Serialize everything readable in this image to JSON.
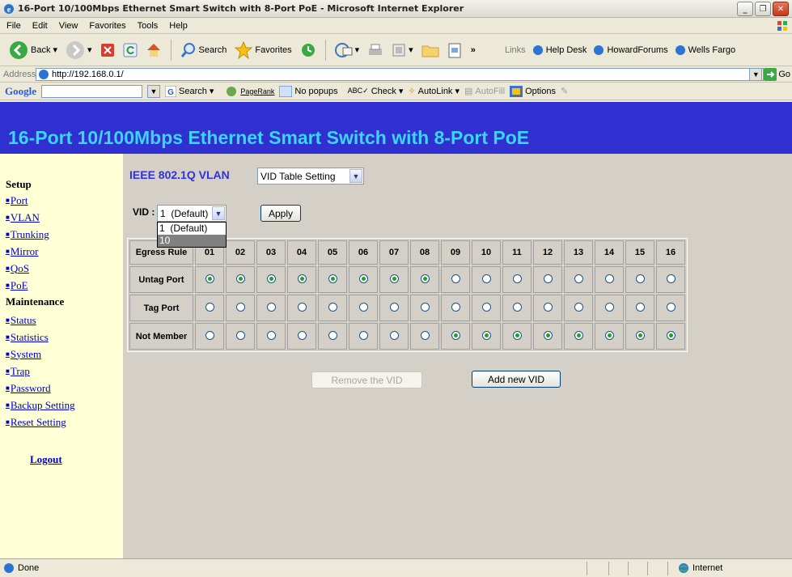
{
  "window": {
    "title": "16-Port 10/100Mbps Ethernet Smart Switch with 8-Port PoE - Microsoft Internet Explorer"
  },
  "menubar": [
    "File",
    "Edit",
    "View",
    "Favorites",
    "Tools",
    "Help"
  ],
  "toolbar": {
    "back": "Back",
    "search": "Search",
    "favorites": "Favorites",
    "links_label": "Links",
    "links": [
      "Help Desk",
      "HowardForums",
      "Wells Fargo"
    ]
  },
  "address": {
    "label": "Address",
    "url": "http://192.168.0.1/",
    "go": "Go"
  },
  "google": {
    "logo": "Google",
    "search": "Search",
    "pagerank": "PageRank",
    "popups": "No popups",
    "check": "Check",
    "autolink": "AutoLink",
    "autofill": "AutoFill",
    "options": "Options"
  },
  "page": {
    "banner": "16-Port 10/100Mbps Ethernet Smart Switch with 8-Port PoE",
    "sidebar": {
      "setup": "Setup",
      "setup_links": [
        "Port",
        "VLAN",
        "Trunking",
        "Mirror",
        "QoS",
        "PoE"
      ],
      "maintenance": "Maintenance",
      "maintenance_links": [
        "Status",
        "Statistics",
        "System",
        "Trap",
        "Password",
        "Backup Setting",
        "Reset Setting"
      ],
      "logout": "Logout"
    },
    "vlan_title": "IEEE 802.1Q VLAN",
    "mode_select": "VID Table Setting",
    "vid_label": "VID :",
    "vid_selected": "1  (Default)",
    "vid_options": [
      "1  (Default)",
      "10"
    ],
    "apply": "Apply",
    "table": {
      "corner": "Egress Rule",
      "ports": [
        "01",
        "02",
        "03",
        "04",
        "05",
        "06",
        "07",
        "08",
        "09",
        "10",
        "11",
        "12",
        "13",
        "14",
        "15",
        "16"
      ],
      "rows": [
        {
          "label": "Untag Port",
          "checked": [
            1,
            1,
            1,
            1,
            1,
            1,
            1,
            1,
            0,
            0,
            0,
            0,
            0,
            0,
            0,
            0
          ]
        },
        {
          "label": "Tag Port",
          "checked": [
            0,
            0,
            0,
            0,
            0,
            0,
            0,
            0,
            0,
            0,
            0,
            0,
            0,
            0,
            0,
            0
          ]
        },
        {
          "label": "Not Member",
          "checked": [
            0,
            0,
            0,
            0,
            0,
            0,
            0,
            0,
            1,
            1,
            1,
            1,
            1,
            1,
            1,
            1
          ]
        }
      ]
    },
    "remove_vid": "Remove the VID",
    "add_vid": "Add new VID"
  },
  "status": {
    "text": "Done",
    "zone": "Internet"
  },
  "colors": {
    "banner_bg": "#3030d0",
    "banner_text": "#3cd5f5",
    "sidebar_bg": "#ffffd6",
    "link": "#0000cc"
  }
}
